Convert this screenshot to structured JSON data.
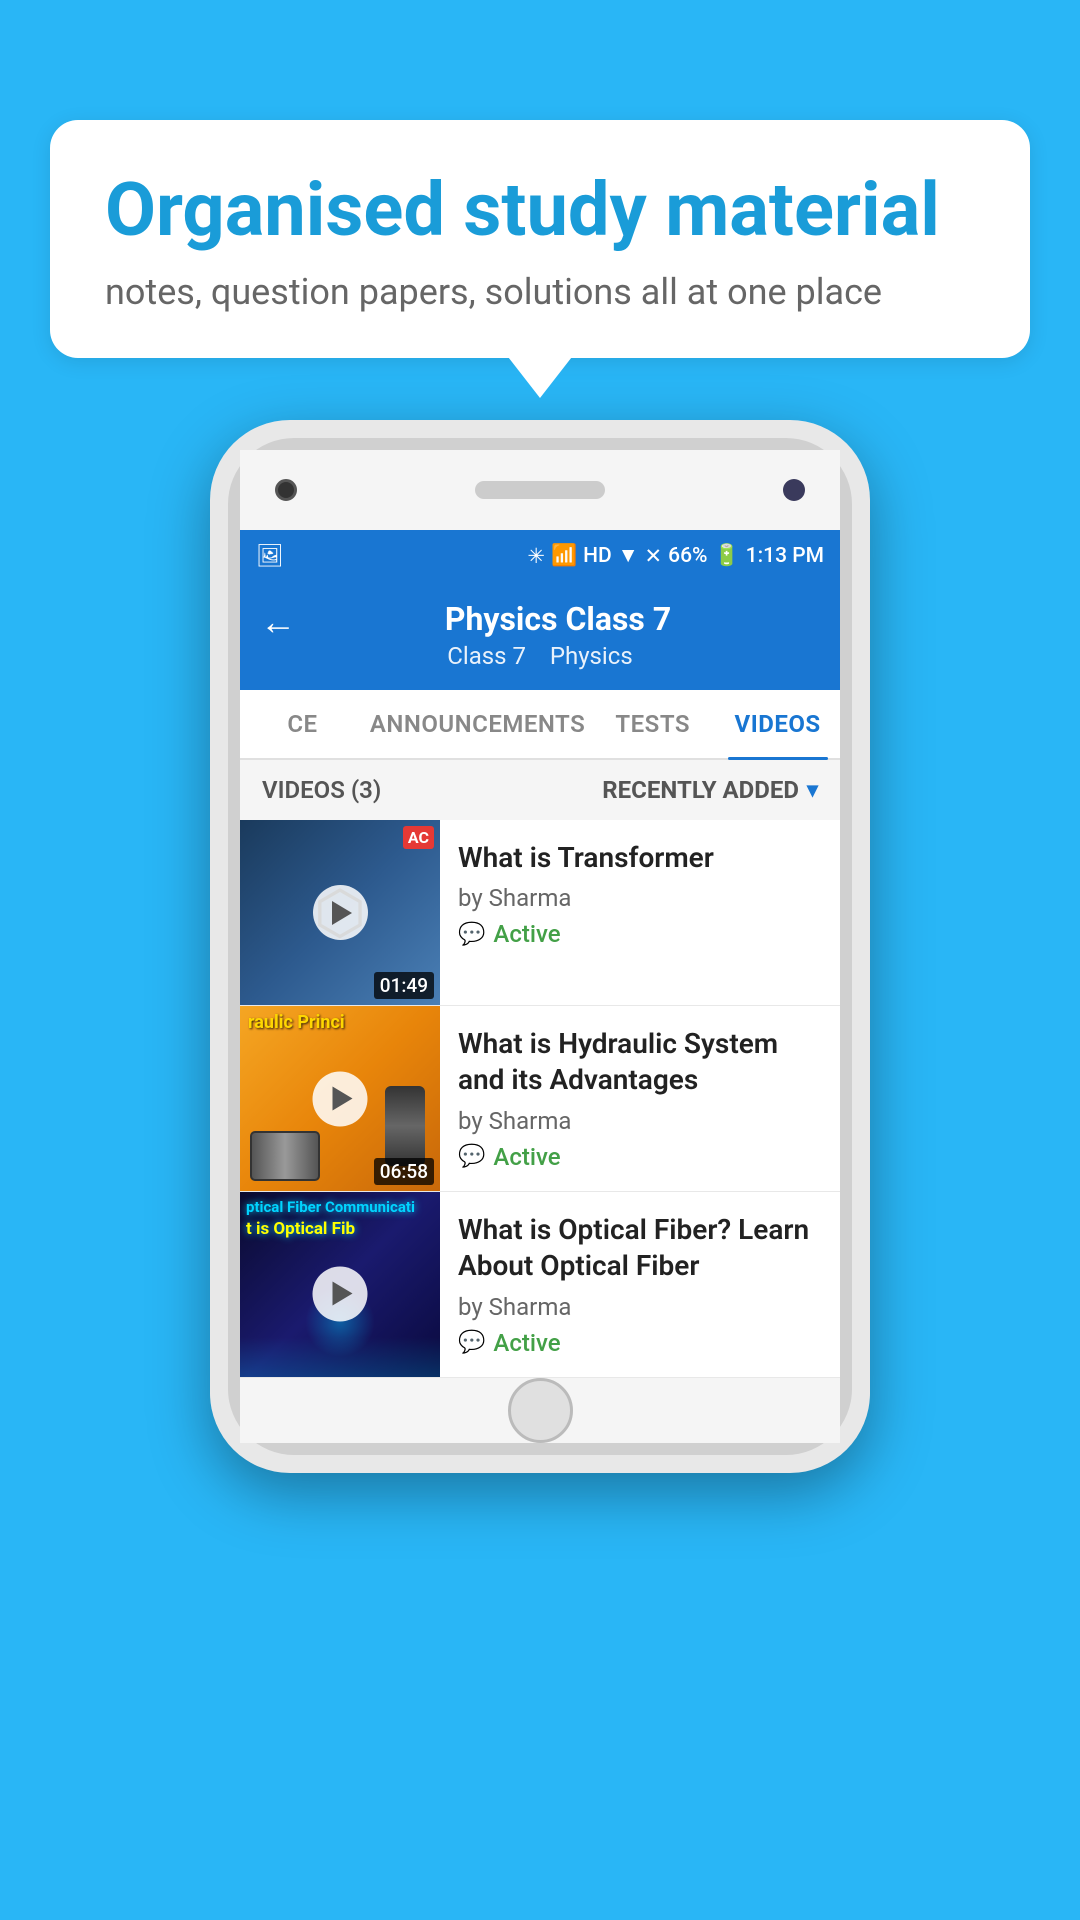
{
  "background_color": "#29b6f6",
  "speech_bubble": {
    "title": "Organised study material",
    "subtitle": "notes, question papers, solutions all at one place"
  },
  "app_bar": {
    "title": "Physics Class 7",
    "subtitle_class": "Class 7",
    "subtitle_subject": "Physics",
    "back_label": "←"
  },
  "tabs": [
    {
      "id": "ce",
      "label": "CE",
      "active": false
    },
    {
      "id": "announcements",
      "label": "ANNOUNCEMENTS",
      "active": false
    },
    {
      "id": "tests",
      "label": "TESTS",
      "active": false
    },
    {
      "id": "videos",
      "label": "VIDEOS",
      "active": true
    }
  ],
  "filter_bar": {
    "count_label": "VIDEOS (3)",
    "sort_label": "RECENTLY ADDED"
  },
  "videos": [
    {
      "title": "What is  Transformer",
      "author": "by Sharma",
      "status": "Active",
      "duration": "01:49",
      "badge": "AC"
    },
    {
      "title": "What is Hydraulic System and its Advantages",
      "author": "by Sharma",
      "status": "Active",
      "duration": "06:58",
      "thumb_text": "raulic Princi"
    },
    {
      "title": "What is Optical Fiber? Learn About Optical Fiber",
      "author": "by Sharma",
      "status": "Active",
      "duration": "",
      "thumb_text": "ptical Fiber Communicati",
      "thumb_text2": "t is Optical Fib"
    }
  ],
  "status_bar": {
    "time": "1:13 PM",
    "battery": "66%",
    "signal": "HD"
  }
}
